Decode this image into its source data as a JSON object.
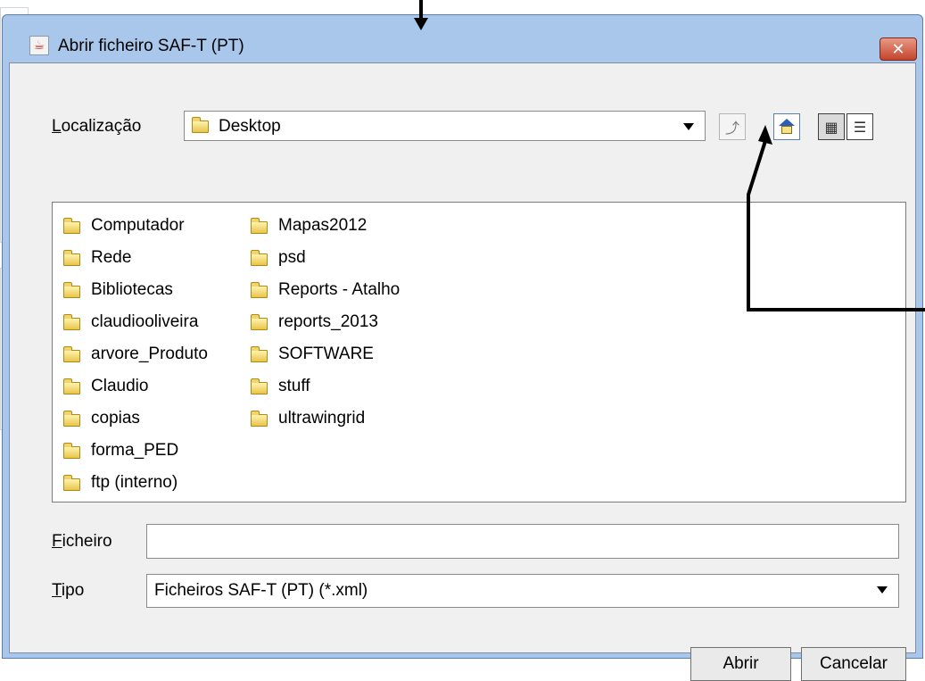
{
  "dialog": {
    "title": "Abrir ficheiro SAF-T (PT)",
    "close_label": "✕"
  },
  "location": {
    "label_accel": "L",
    "label_rest": "ocalização",
    "value": "Desktop"
  },
  "toolbar": {
    "up_icon": "up-folder-icon",
    "home_icon": "home-icon",
    "list_icon": "list-view-icon",
    "details_icon": "details-view-icon",
    "list_glyph": "▦",
    "details_glyph": "☰",
    "up_glyph": "⤴"
  },
  "files": {
    "column1": [
      "Computador",
      "Rede",
      "Bibliotecas",
      "claudiooliveira",
      "arvore_Produto",
      "Claudio",
      "copias",
      "forma_PED",
      "ftp (interno)"
    ],
    "column2": [
      "Mapas2012",
      "psd",
      "Reports - Atalho",
      "reports_2013",
      "SOFTWARE",
      "stuff",
      "ultrawingrid"
    ]
  },
  "filename": {
    "label_accel": "F",
    "label_rest": "icheiro",
    "value": ""
  },
  "filetype": {
    "label_accel": "T",
    "label_rest": "ipo",
    "value": "Ficheiros SAF-T (PT) (*.xml)"
  },
  "buttons": {
    "open": "Abrir",
    "cancel": "Cancelar"
  },
  "colors": {
    "title_bar": "#a9c7ea",
    "client_bg": "#f0f0f0",
    "close_button": "#c4432c"
  }
}
